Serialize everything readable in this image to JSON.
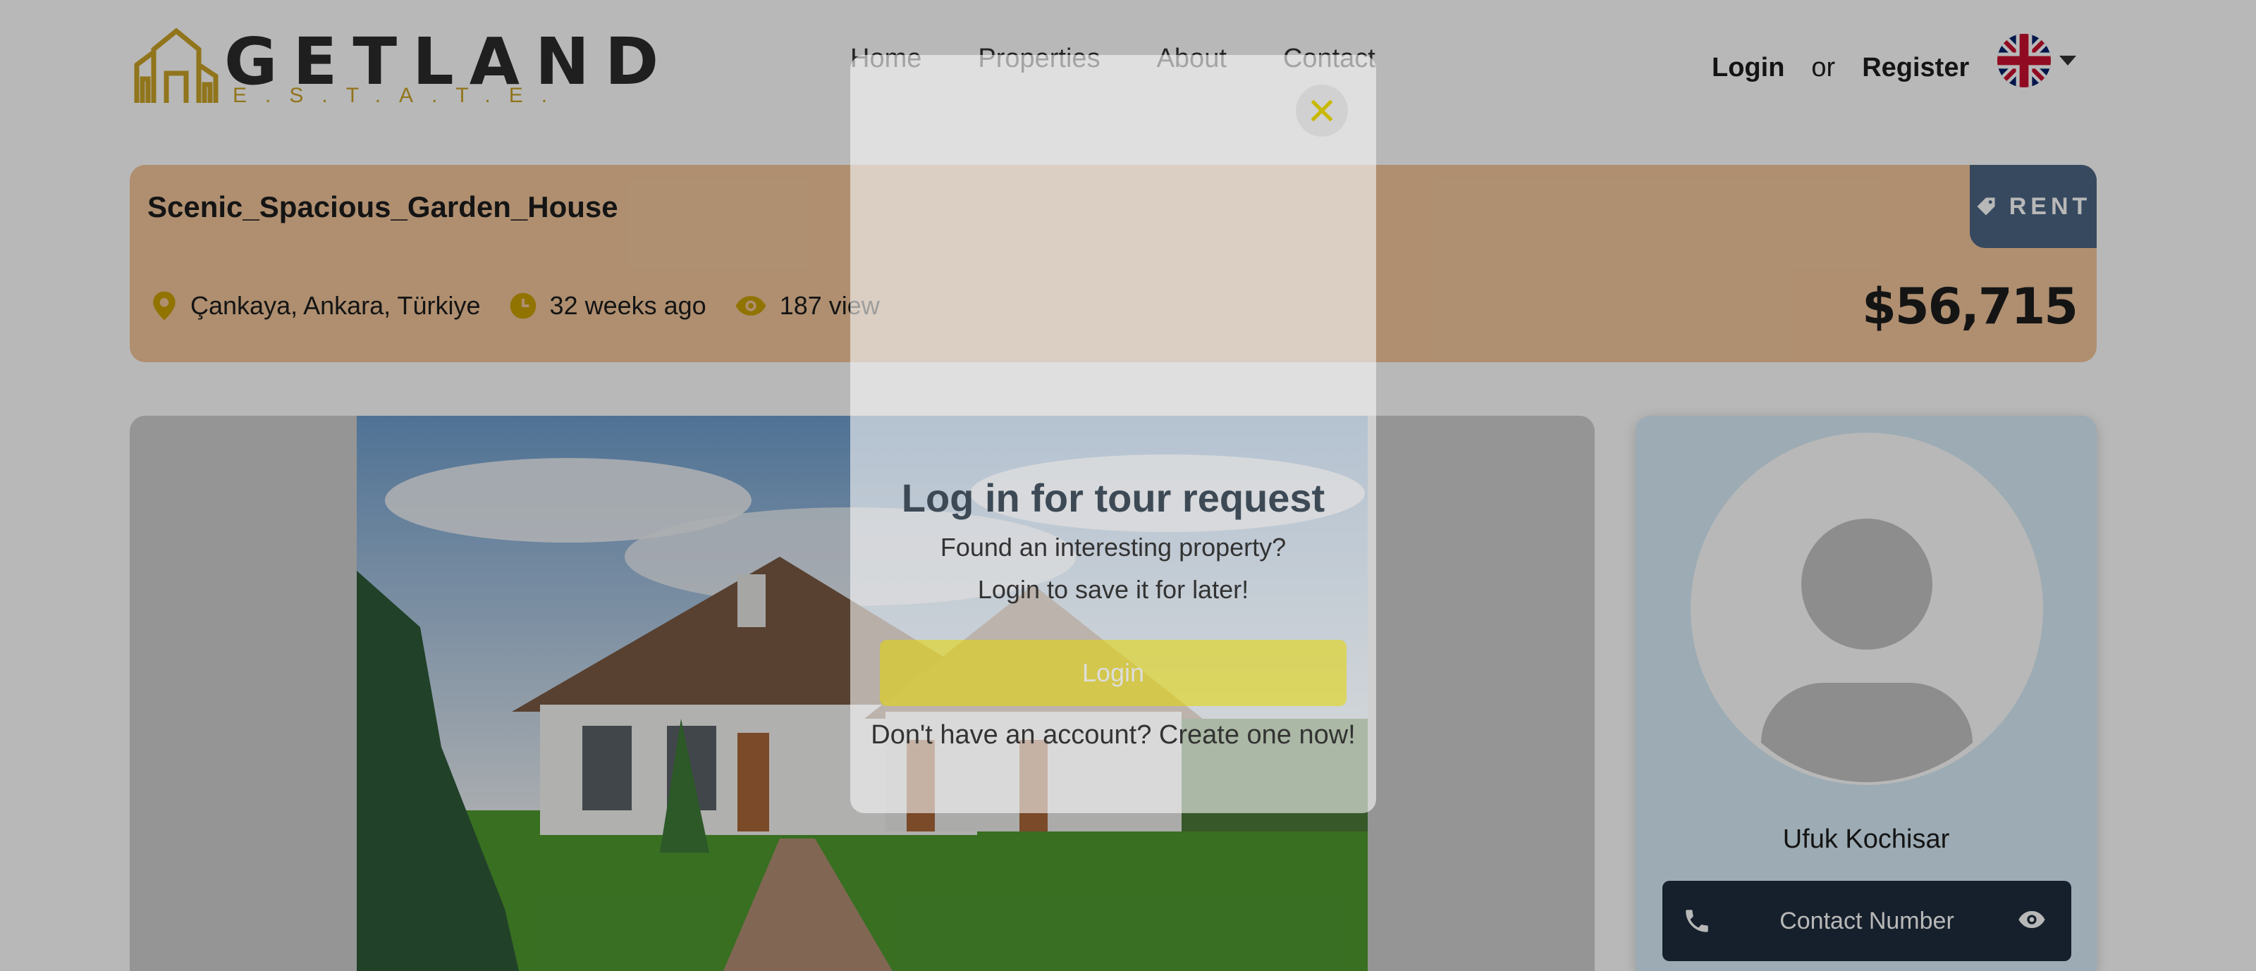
{
  "brand": {
    "name": "GETLAND",
    "tagline": "E.S.T.A.T.E."
  },
  "nav": {
    "home": "Home",
    "properties": "Properties",
    "about": "About",
    "contact": "Contact"
  },
  "auth": {
    "login": "Login",
    "or": "or",
    "register": "Register",
    "language_icon": "uk-flag-icon"
  },
  "listing": {
    "title": "Scenic_Spacious_Garden_House",
    "badge": "RENT",
    "location": "Çankaya, Ankara, Türkiye",
    "posted": "32 weeks ago",
    "views": "187 view",
    "price": "$56,715"
  },
  "agent": {
    "name": "Ufuk Kochisar",
    "contact_label": "Contact Number"
  },
  "modal": {
    "title": "Log in for tour request",
    "line1": "Found an interesting property?",
    "line2": "Login to save it for later!",
    "login_button": "Login",
    "signup": "Don't have an account? Create one now!"
  },
  "colors": {
    "accent": "#c9a227",
    "banner": "#f3c79b",
    "badge": "#4b6684",
    "dark_button": "#1f2d3d",
    "agent_card": "#d9eefa"
  }
}
